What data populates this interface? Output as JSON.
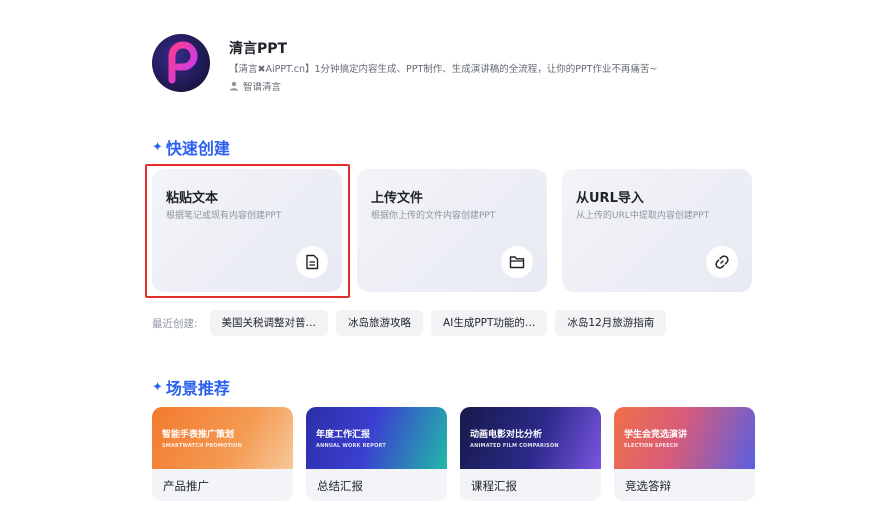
{
  "app": {
    "title": "清言PPT",
    "description": "【清言✖AiPPT.cn】1分钟搞定内容生成、PPT制作、生成演讲稿的全流程，让你的PPT作业不再痛苦~",
    "author": "智谱清言",
    "logo_icon": "p-logo-icon",
    "logo_color": "#ff3c8c"
  },
  "quick_create": {
    "title": "快速创建",
    "cards": [
      {
        "title": "粘贴文本",
        "subtitle": "根据笔记或现有内容创建PPT",
        "icon": "document-icon",
        "highlighted": true
      },
      {
        "title": "上传文件",
        "subtitle": "根据你上传的文件内容创建PPT",
        "icon": "folder-icon",
        "highlighted": false
      },
      {
        "title": "从URL导入",
        "subtitle": "从上传的URL中提取内容创建PPT",
        "icon": "link-icon",
        "highlighted": false
      }
    ]
  },
  "recent": {
    "label": "最近创建:",
    "items": [
      "美国关税调整对普…",
      "冰岛旅游攻略",
      "AI生成PPT功能的…",
      "冰岛12月旅游指南"
    ]
  },
  "scenes": {
    "title": "场景推荐",
    "items": [
      {
        "banner_title": "智能手表推广策划",
        "banner_sub": "SMARTWATCH PROMOTION",
        "label": "产品推广",
        "colors": [
          "#f08a3c",
          "#f6b072"
        ]
      },
      {
        "banner_title": "年度工作汇报",
        "banner_sub": "ANNUAL WORK REPORT",
        "label": "总结汇报",
        "colors": [
          "#2b2f9e",
          "#27c2b0"
        ]
      },
      {
        "banner_title": "动画电影对比分析",
        "banner_sub": "ANIMATED FILM COMPARISON",
        "label": "课程汇报",
        "colors": [
          "#1a1d55",
          "#6a4fd8"
        ]
      },
      {
        "banner_title": "学生会竞选演讲",
        "banner_sub": "ELECTION SPEECH",
        "label": "竞选答辩",
        "colors": [
          "#e86a54",
          "#5a5fe0"
        ]
      }
    ]
  },
  "colors": {
    "accent": "#2b5ff0",
    "highlight_border": "#e5312c"
  }
}
